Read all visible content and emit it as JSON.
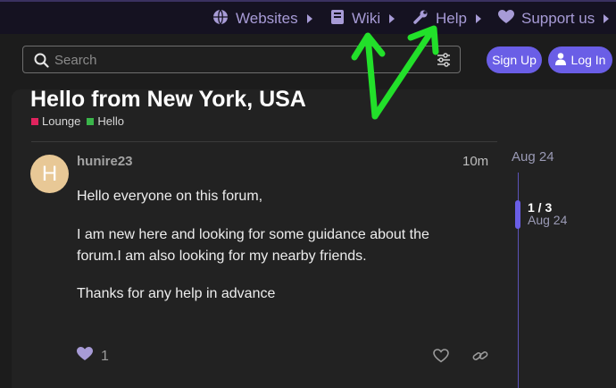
{
  "nav": {
    "items": [
      {
        "label": "Websites",
        "icon": "globe-icon"
      },
      {
        "label": "Wiki",
        "icon": "book-icon"
      },
      {
        "label": "Help",
        "icon": "wrench-icon"
      },
      {
        "label": "Support us",
        "icon": "heart-icon"
      }
    ]
  },
  "header": {
    "search_placeholder": "Search",
    "signup_label": "Sign Up",
    "login_label": "Log In"
  },
  "topic": {
    "title": "Hello from New York, USA",
    "categories": [
      {
        "label": "Lounge",
        "color": "#e0245e"
      },
      {
        "label": "Hello",
        "color": "#3ab54a"
      }
    ]
  },
  "post": {
    "avatar_letter": "H",
    "avatar_color": "#e8c896",
    "username": "hunire23",
    "time": "10m",
    "paragraphs": [
      "Hello everyone on this forum,",
      "I am new here and looking for some guidance about the forum.I am also looking for my nearby friends.",
      "Thanks for any help in advance"
    ],
    "like_count": "1"
  },
  "timeline": {
    "start_date": "Aug 24",
    "position": "1 / 3",
    "current_date": "Aug 24"
  },
  "colors": {
    "accent": "#6a5ee6",
    "nav_text": "#a79bd6",
    "annotation_arrow": "#22e02a"
  }
}
